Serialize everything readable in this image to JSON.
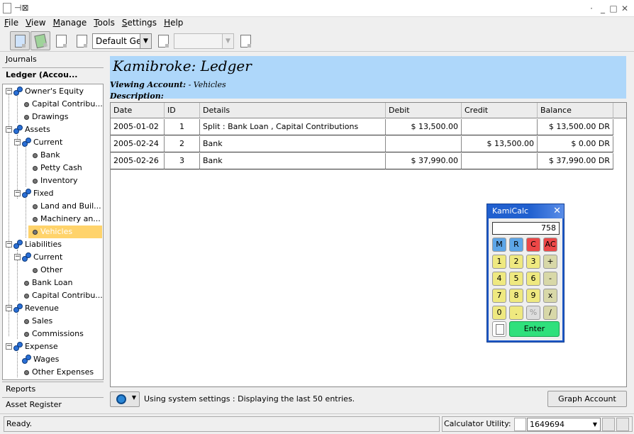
{
  "menu": [
    "File",
    "View",
    "Manage",
    "Tools",
    "Settings",
    "Help"
  ],
  "menu_accel": [
    "F",
    "V",
    "M",
    "T",
    "S",
    "H"
  ],
  "toolbar": {
    "period_combo": "Default Ger",
    "second_combo": ""
  },
  "sidebar": {
    "tab_journals": "Journals",
    "tab_ledger": "Ledger (Accou...",
    "tab_reports": "Reports",
    "tab_asset_register": "Asset Register",
    "tree": [
      {
        "label": "Owner's Equity"
      },
      {
        "label": "Capital Contribu..."
      },
      {
        "label": "Drawings"
      },
      {
        "label": "Assets"
      },
      {
        "label": "Current"
      },
      {
        "label": "Bank"
      },
      {
        "label": "Petty Cash"
      },
      {
        "label": "Inventory"
      },
      {
        "label": "Fixed"
      },
      {
        "label": "Land and Buil..."
      },
      {
        "label": "Machinery an..."
      },
      {
        "label": "Vehicles"
      },
      {
        "label": "Liabilities"
      },
      {
        "label": "Current"
      },
      {
        "label": "Other"
      },
      {
        "label": "Bank Loan"
      },
      {
        "label": "Capital Contribu..."
      },
      {
        "label": "Revenue"
      },
      {
        "label": "Sales"
      },
      {
        "label": "Commissions"
      },
      {
        "label": "Expense"
      },
      {
        "label": "Wages"
      },
      {
        "label": "Other Expenses"
      }
    ]
  },
  "header": {
    "title": "Kamibroke:  Ledger",
    "viewing_label": "Viewing Account:",
    "viewing_value": " - Vehicles",
    "description_label": "Description:"
  },
  "table": {
    "columns": [
      "Date",
      "ID",
      "Details",
      "Debit",
      "Credit",
      "Balance"
    ],
    "rows": [
      [
        "2005-01-02",
        "1",
        "Split : Bank Loan , Capital Contributions",
        "$ 13,500.00",
        "",
        "$ 13,500.00 DR"
      ],
      [
        "2005-02-24",
        "2",
        "Bank",
        "",
        "$ 13,500.00",
        "$ 0.00 DR"
      ],
      [
        "2005-02-26",
        "3",
        "Bank",
        "$ 37,990.00",
        "",
        "$ 37,990.00 DR"
      ]
    ]
  },
  "footer": {
    "status_message": "Using system settings : Displaying the last 50 entries.",
    "graph_button": "Graph Account"
  },
  "calculator": {
    "title": "KamiCalc",
    "display": "758",
    "keys": [
      [
        "M",
        "R",
        "C",
        "AC"
      ],
      [
        "1",
        "2",
        "3",
        "+"
      ],
      [
        "4",
        "5",
        "6",
        "-"
      ],
      [
        "7",
        "8",
        "9",
        "x"
      ],
      [
        "0",
        ".",
        "%",
        "/"
      ]
    ],
    "enter": "Enter"
  },
  "statusbar": {
    "ready": "Ready.",
    "calc_utility_label": "Calculator Utility:",
    "calc_utility_value": "1649694"
  }
}
